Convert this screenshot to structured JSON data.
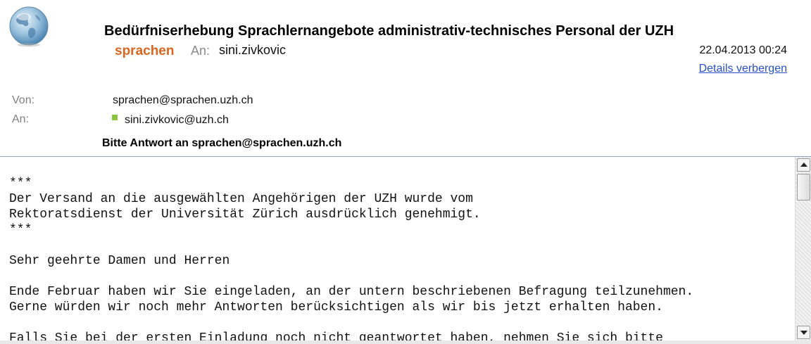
{
  "message": {
    "subject": "Bedürfniserhebung Sprachlernangebote administrativ-technisches Personal der UZH",
    "sender_name": "sprachen",
    "to_label": "An:",
    "to_short": "sini.zivkovic",
    "date": "22.04.2013 00:24",
    "details_link": "Details verbergen"
  },
  "fields": {
    "from_label": "Von:",
    "from_value": "sprachen@sprachen.uzh.ch",
    "to_label": "An:",
    "to_value": "sini.zivkovic@uzh.ch",
    "reply_to": "Bitte Antwort an sprachen@sprachen.uzh.ch"
  },
  "body": {
    "text": "***\nDer Versand an die ausgewählten Angehörigen der UZH wurde vom\nRektoratsdienst der Universität Zürich ausdrücklich genehmigt.\n***\n\nSehr geehrte Damen und Herren\n\nEnde Februar haben wir Sie eingeladen, an der untern beschriebenen Befragung teilzunehmen.\nGerne würden wir noch mehr Antworten berücksichtigen als wir bis jetzt erhalten haben.\n\nFalls Sie bei der ersten Einladung noch nicht geantwortet haben, nehmen Sie sich bitte"
  },
  "icons": {
    "app_icon": "globe-icon",
    "status_icon": "online-status-icon"
  },
  "colors": {
    "sender": "#d9661e",
    "link": "#2850c8",
    "status": "#8cc63f"
  }
}
